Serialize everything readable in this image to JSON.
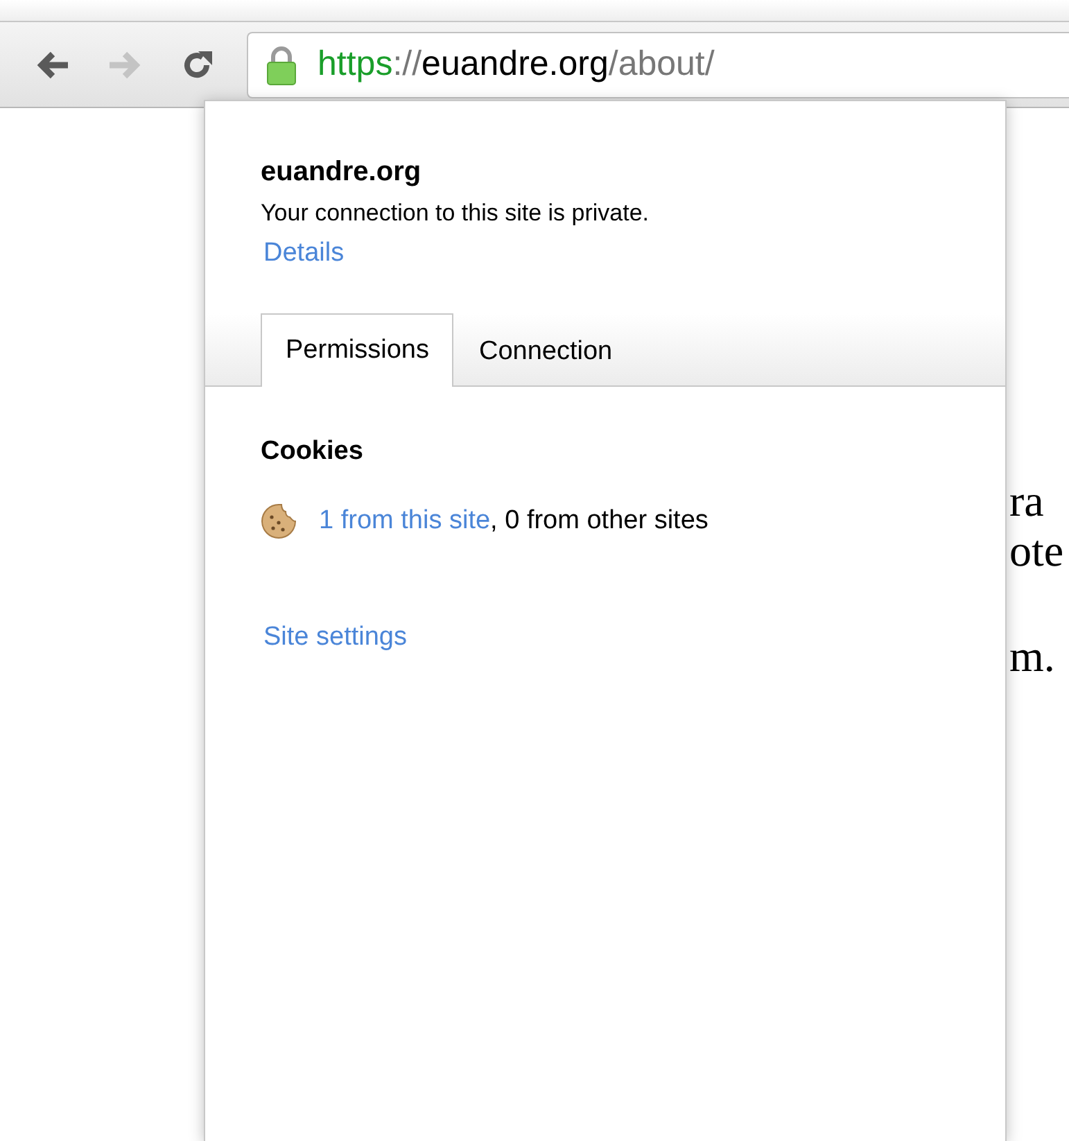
{
  "toolbar": {
    "back": {
      "disabled": false
    },
    "forward": {
      "disabled": true
    },
    "url": {
      "secure": true,
      "scheme": "https",
      "separator": "://",
      "host": "euandre.org",
      "path": "/about/"
    }
  },
  "popup": {
    "site": "euandre.org",
    "status": "Your connection to this site is private.",
    "details_link": "Details",
    "tabs": [
      {
        "label": "Permissions",
        "selected": true
      },
      {
        "label": "Connection",
        "selected": false
      }
    ],
    "section_title": "Cookies",
    "cookies": {
      "link": "1 from this site",
      "rest": ", 0 from other sites"
    },
    "settings_link": "Site settings"
  },
  "page_text": [
    {
      "lines": [
        "ra",
        "ote"
      ]
    },
    {
      "lines": [
        "m."
      ]
    }
  ]
}
